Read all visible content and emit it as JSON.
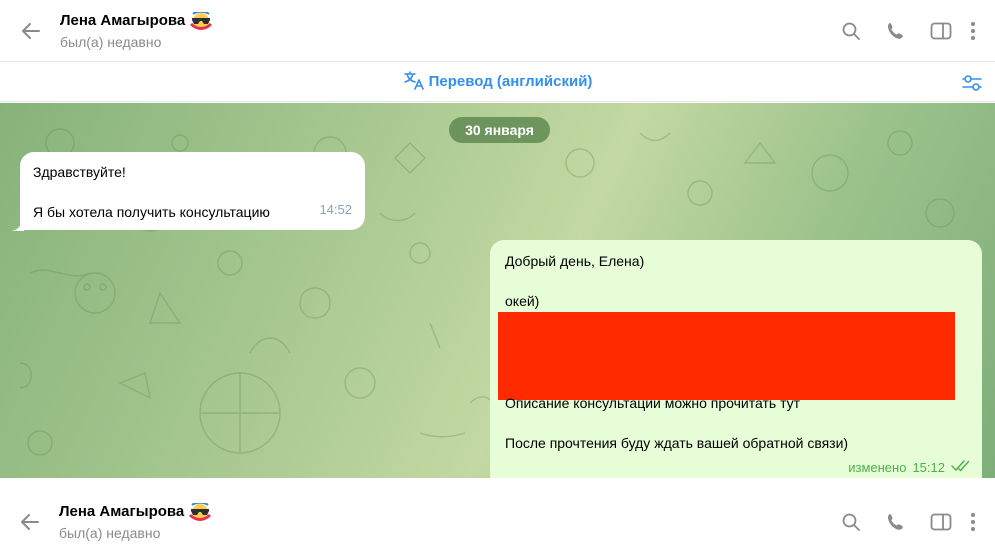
{
  "header": {
    "contact_name": "Лена Амагырова",
    "status": "был(а) недавно",
    "icons": [
      "back-arrow-icon",
      "search-icon",
      "phone-icon",
      "sidebar-toggle-icon",
      "more-vertical-icon"
    ]
  },
  "translate_bar": {
    "label": "Перевод (английский)",
    "icon": "translate-icon",
    "settings_icon": "translate-settings-icon",
    "accent_color": "#3390ec"
  },
  "chat": {
    "date_chip": "30 января",
    "messages": [
      {
        "direction": "incoming",
        "lines": [
          "Здравствуйте!",
          "",
          "Я бы хотела получить консультацию"
        ],
        "time": "14:52"
      },
      {
        "direction": "outgoing",
        "lines": [
          "Добрый день, Елена)",
          "",
          "окей)"
        ],
        "redacted": true,
        "lines_after": [
          "Описание консультации можно прочитать тут",
          "",
          "После прочтения буду ждать вашей обратной связи)"
        ],
        "edited_label": "изменено",
        "time": "15:12",
        "read_icon": "double-check-icon"
      }
    ]
  },
  "header_bottom": {
    "contact_name": "Лена Амагырова",
    "status": "был(а) недавно"
  },
  "colors": {
    "outgoing_bubble": "#e7fdd7",
    "incoming_bubble": "#ffffff",
    "redaction": "#ff2a00",
    "read_check": "#4fae4e"
  }
}
